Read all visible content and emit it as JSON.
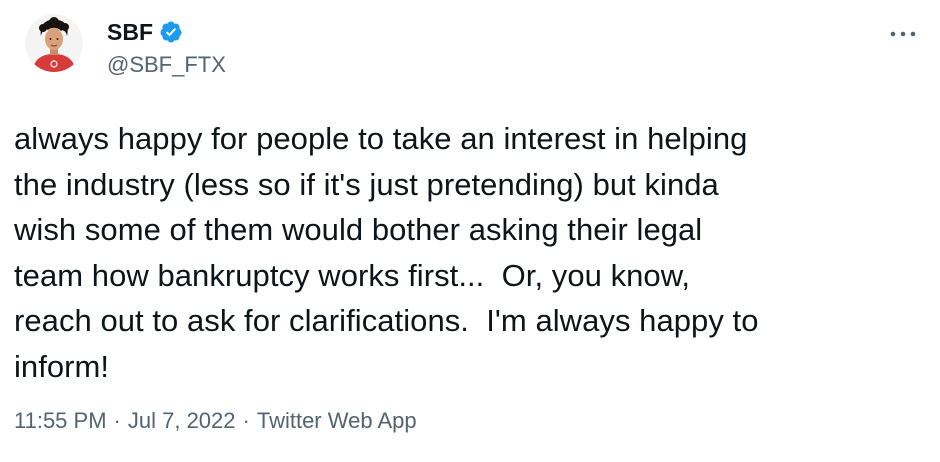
{
  "author": {
    "display_name": "SBF",
    "handle": "@SBF_FTX",
    "verified": true,
    "avatar_icon": "profile-photo-avatar",
    "verified_icon": "verified-badge-icon"
  },
  "tweet": {
    "text": "always happy for people to take an interest in helping\nthe industry (less so if it's just pretending) but kinda\nwish some of them would bother asking their legal\nteam how bankruptcy works first...  Or, you know,\nreach out to ask for clarifications.  I'm always happy to\ninform!"
  },
  "meta": {
    "time": "11:55 PM",
    "separator": "·",
    "date": "Jul 7, 2022",
    "source": "Twitter Web App"
  },
  "menu": {
    "icon": "more-options-icon"
  },
  "colors": {
    "text_primary": "#0f1419",
    "text_secondary": "#536471",
    "verified_blue": "#1d9bf0",
    "avatar_shirt": "#d93a3a"
  }
}
